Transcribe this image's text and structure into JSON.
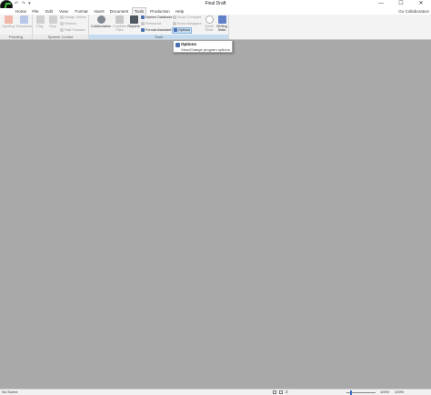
{
  "window": {
    "title": "Final Draft",
    "quick_access": "↶ ↷ ▾",
    "minimize": "—",
    "maximize": "☐",
    "close": "✕"
  },
  "tabs": [
    "Home",
    "File",
    "Edit",
    "View",
    "Format",
    "Insert",
    "Document",
    "Tools",
    "Production",
    "Help"
  ],
  "active_tab": "Tools",
  "collaboration_link": "Go Collaboration",
  "ribbon": {
    "proofing": {
      "label": "Proofing",
      "spelling": "Spelling",
      "thesaurus": "Thesaurus"
    },
    "speech": {
      "label": "Speech Control",
      "play": "Play",
      "stop": "Stop",
      "assign_voices": "Assign Voices",
      "rewind": "Rewind",
      "fast_forward": "Fast Forward"
    },
    "tools": {
      "label": "Tools",
      "collaboration": "Collaboration",
      "combine_files": "Combine Files",
      "reports": "Reports",
      "names_database": "Names Database",
      "rehearsal": "Rehearsal",
      "format_assistant": "Format Assistant",
      "script_compare": "Script Compare",
      "show_navigator": "Show Navigator",
      "options": "Options",
      "sprint_timer": "Sprint Timer",
      "writing_stats": "Writing Stats"
    }
  },
  "dropdown": {
    "title": "Options",
    "description": "View/Change program options."
  },
  "status": {
    "scene": "No Scene",
    "page": "2",
    "zoom_a": "100%",
    "zoom_b": "100%"
  },
  "zoom_level": 0.15,
  "colors": {
    "workspace": "#a9a9a9",
    "ribbon": "#f3f3f3",
    "highlight": "#c5dcf0",
    "accent": "#3a6fc4"
  }
}
